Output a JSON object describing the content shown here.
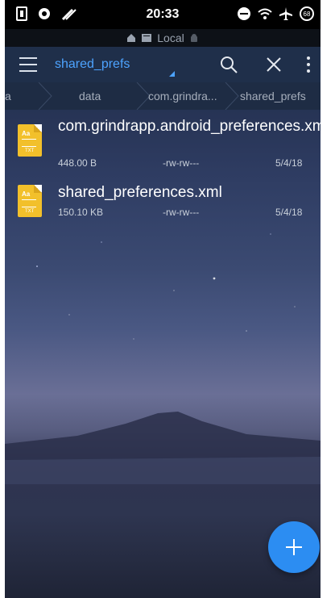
{
  "status_bar": {
    "time": "20:33",
    "battery_level": "68",
    "left_icons": [
      "notification-icon",
      "settings-app-icon",
      "no-signal-icon"
    ],
    "right_icons": [
      "do-not-disturb-icon",
      "wifi-icon",
      "airplane-icon",
      "battery-icon"
    ]
  },
  "location": {
    "label": "Local"
  },
  "toolbar": {
    "path_title": "shared_prefs"
  },
  "breadcrumb": {
    "items": [
      "a",
      "data",
      "com.grindra...",
      "shared_prefs"
    ]
  },
  "files": [
    {
      "name": "com.grindrapp.android_preferences.xml",
      "size": "448.00 B",
      "permissions": "-rw-rw---",
      "date": "5/4/18"
    },
    {
      "name": "shared_preferences.xml",
      "size": "150.10 KB",
      "permissions": "-rw-rw---",
      "date": "5/4/18"
    }
  ],
  "colors": {
    "accent": "#4da3ff",
    "toolbar_bg": "#1f2f4a",
    "fab": "#2c8df2",
    "file_icon": "#f2c02b"
  }
}
